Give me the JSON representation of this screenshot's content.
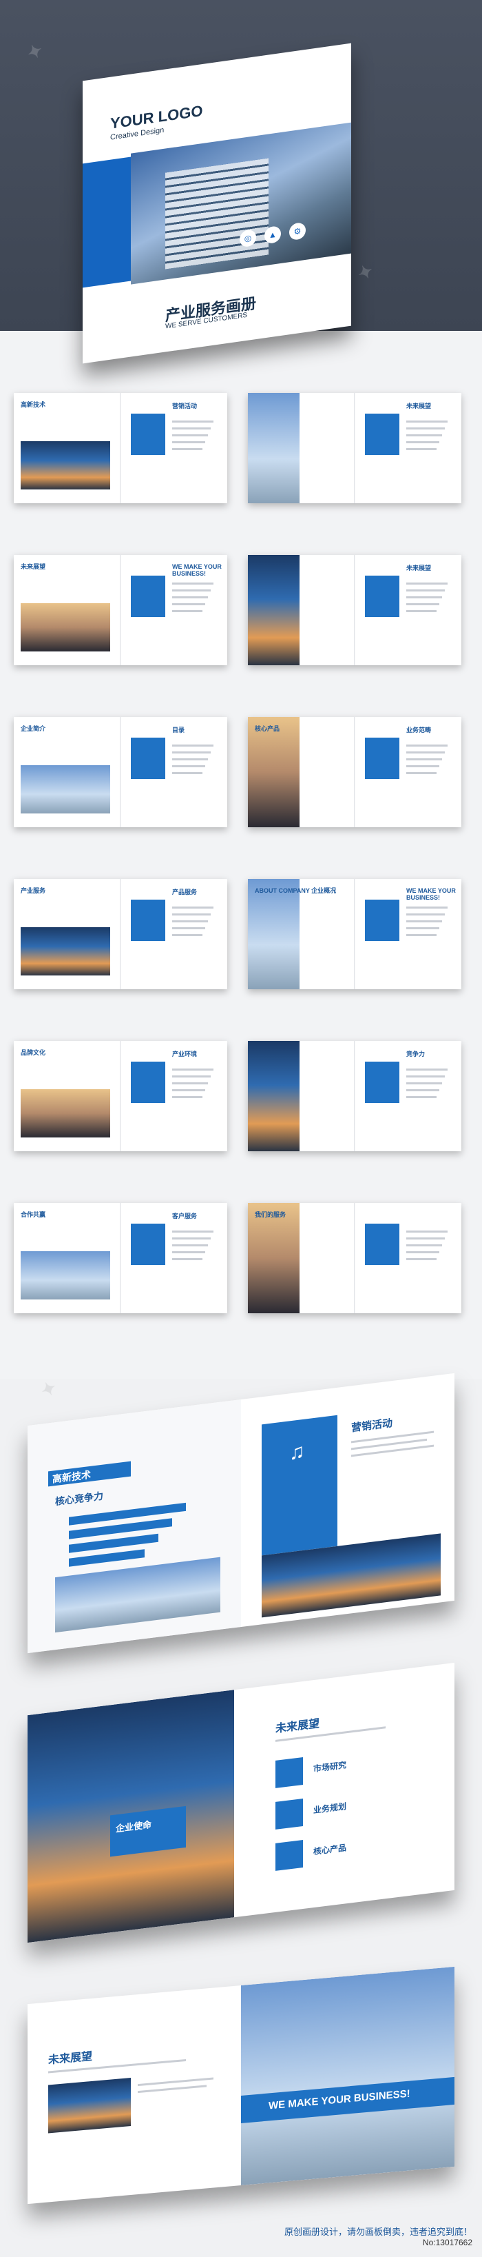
{
  "cover": {
    "logo": "YOUR LOGO",
    "logo_sub": "Creative Design",
    "title": "产业服务画册",
    "subtitle": "WE SERVE CUSTOMERS"
  },
  "spreads": [
    {
      "left_title": "高新技术",
      "right_title": "营销活动"
    },
    {
      "left_title": "",
      "right_title": "未来展望"
    },
    {
      "left_title": "未来展望",
      "right_title": "WE MAKE YOUR BUSINESS!"
    },
    {
      "left_title": "",
      "right_title": "未来展望"
    },
    {
      "left_title": "企业简介",
      "right_title": "目录"
    },
    {
      "left_title": "核心产品",
      "right_title": "业务范畴"
    },
    {
      "left_title": "产业服务",
      "right_title": "产品服务"
    },
    {
      "left_title": "ABOUT COMPANY 企业概况",
      "right_title": "WE MAKE YOUR BUSINESS!"
    },
    {
      "left_title": "品牌文化",
      "right_title": "产业环境"
    },
    {
      "left_title": "",
      "right_title": "竞争力"
    },
    {
      "left_title": "合作共赢",
      "right_title": "客户服务"
    },
    {
      "left_title": "我们的服务",
      "right_title": ""
    }
  ],
  "big": {
    "b1_left": "核心竞争力",
    "b1_left_tag": "高新技术",
    "b1_right": "营销活动",
    "b2_left": "企业使命",
    "b2_right": "未来展望",
    "b2_items": [
      "市场研究",
      "业务规划",
      "核心产品"
    ],
    "b3_left": "未来展望",
    "b3_right": "WE MAKE YOUR BUSINESS!"
  },
  "footer": {
    "note": "原创画册设计，请勿画板倒卖，违者追究到底！",
    "number": "No:13017662"
  },
  "colors": {
    "accent": "#1f72c4",
    "dark_bg": "#3d4553"
  }
}
